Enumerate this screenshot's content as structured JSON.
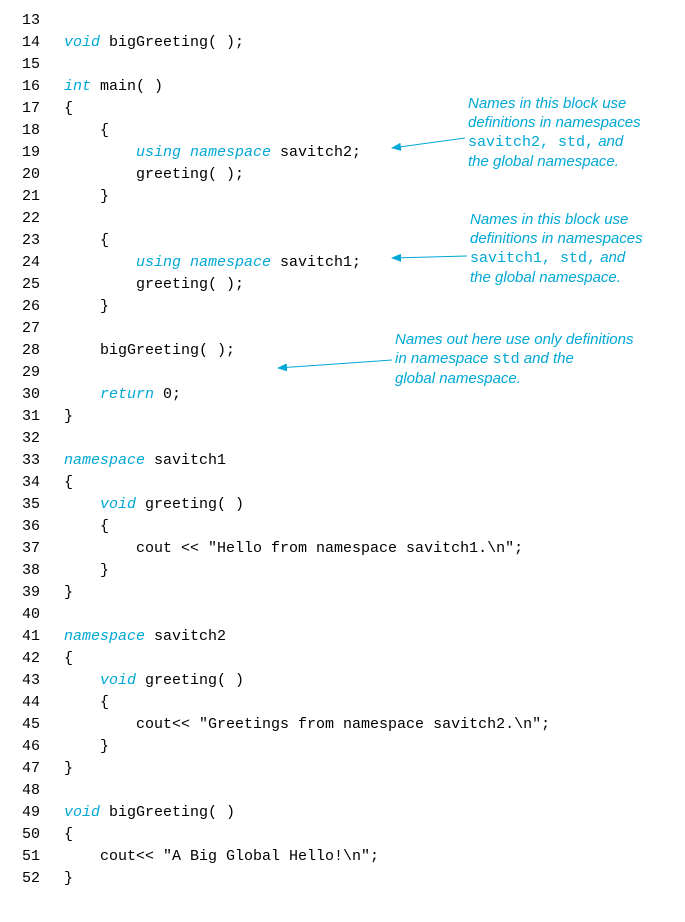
{
  "lines": [
    {
      "n": "13",
      "indent": "",
      "tokens": []
    },
    {
      "n": "14",
      "indent": "",
      "tokens": [
        {
          "t": "void",
          "c": "kw"
        },
        {
          "t": " bigGreeting( );"
        }
      ]
    },
    {
      "n": "15",
      "indent": "",
      "tokens": []
    },
    {
      "n": "16",
      "indent": "",
      "tokens": [
        {
          "t": "int",
          "c": "kw"
        },
        {
          "t": " main( )"
        }
      ]
    },
    {
      "n": "17",
      "indent": "",
      "tokens": [
        {
          "t": "{"
        }
      ]
    },
    {
      "n": "18",
      "indent": "    ",
      "tokens": [
        {
          "t": "{"
        }
      ]
    },
    {
      "n": "19",
      "indent": "        ",
      "tokens": [
        {
          "t": "using namespace",
          "c": "kw"
        },
        {
          "t": " savitch2;"
        }
      ]
    },
    {
      "n": "20",
      "indent": "        ",
      "tokens": [
        {
          "t": "greeting( );"
        }
      ]
    },
    {
      "n": "21",
      "indent": "    ",
      "tokens": [
        {
          "t": "}"
        }
      ]
    },
    {
      "n": "22",
      "indent": "",
      "tokens": []
    },
    {
      "n": "23",
      "indent": "    ",
      "tokens": [
        {
          "t": "{"
        }
      ]
    },
    {
      "n": "24",
      "indent": "        ",
      "tokens": [
        {
          "t": "using namespace",
          "c": "kw"
        },
        {
          "t": " savitch1;"
        }
      ]
    },
    {
      "n": "25",
      "indent": "        ",
      "tokens": [
        {
          "t": "greeting( );"
        }
      ]
    },
    {
      "n": "26",
      "indent": "    ",
      "tokens": [
        {
          "t": "}"
        }
      ]
    },
    {
      "n": "27",
      "indent": "",
      "tokens": []
    },
    {
      "n": "28",
      "indent": "    ",
      "tokens": [
        {
          "t": "bigGreeting( );"
        }
      ]
    },
    {
      "n": "29",
      "indent": "",
      "tokens": []
    },
    {
      "n": "30",
      "indent": "    ",
      "tokens": [
        {
          "t": "return",
          "c": "kw"
        },
        {
          "t": " 0;"
        }
      ]
    },
    {
      "n": "31",
      "indent": "",
      "tokens": [
        {
          "t": "}"
        }
      ]
    },
    {
      "n": "32",
      "indent": "",
      "tokens": []
    },
    {
      "n": "33",
      "indent": "",
      "tokens": [
        {
          "t": "namespace",
          "c": "kw"
        },
        {
          "t": " savitch1"
        }
      ]
    },
    {
      "n": "34",
      "indent": "",
      "tokens": [
        {
          "t": "{"
        }
      ]
    },
    {
      "n": "35",
      "indent": "    ",
      "tokens": [
        {
          "t": "void",
          "c": "kw"
        },
        {
          "t": " greeting( )"
        }
      ]
    },
    {
      "n": "36",
      "indent": "    ",
      "tokens": [
        {
          "t": "{"
        }
      ]
    },
    {
      "n": "37",
      "indent": "        ",
      "tokens": [
        {
          "t": "cout << \"Hello from namespace savitch1.\\n\";"
        }
      ]
    },
    {
      "n": "38",
      "indent": "    ",
      "tokens": [
        {
          "t": "}"
        }
      ]
    },
    {
      "n": "39",
      "indent": "",
      "tokens": [
        {
          "t": "}"
        }
      ]
    },
    {
      "n": "40",
      "indent": "",
      "tokens": []
    },
    {
      "n": "41",
      "indent": "",
      "tokens": [
        {
          "t": "namespace",
          "c": "kw"
        },
        {
          "t": " savitch2"
        }
      ]
    },
    {
      "n": "42",
      "indent": "",
      "tokens": [
        {
          "t": "{"
        }
      ]
    },
    {
      "n": "43",
      "indent": "    ",
      "tokens": [
        {
          "t": "void",
          "c": "kw"
        },
        {
          "t": " greeting( )"
        }
      ]
    },
    {
      "n": "44",
      "indent": "    ",
      "tokens": [
        {
          "t": "{"
        }
      ]
    },
    {
      "n": "45",
      "indent": "        ",
      "tokens": [
        {
          "t": "cout<< \"Greetings from namespace savitch2.\\n\";"
        }
      ]
    },
    {
      "n": "46",
      "indent": "    ",
      "tokens": [
        {
          "t": "}"
        }
      ]
    },
    {
      "n": "47",
      "indent": "",
      "tokens": [
        {
          "t": "}"
        }
      ]
    },
    {
      "n": "48",
      "indent": "",
      "tokens": []
    },
    {
      "n": "49",
      "indent": "",
      "tokens": [
        {
          "t": "void",
          "c": "kw"
        },
        {
          "t": " bigGreeting( )"
        }
      ]
    },
    {
      "n": "50",
      "indent": "",
      "tokens": [
        {
          "t": "{"
        }
      ]
    },
    {
      "n": "51",
      "indent": "    ",
      "tokens": [
        {
          "t": "cout<< \"A Big Global Hello!\\n\";"
        }
      ]
    },
    {
      "n": "52",
      "indent": "",
      "tokens": [
        {
          "t": "}"
        }
      ]
    }
  ],
  "annotations": {
    "a1": {
      "pre1": "Names in this block use",
      "pre2": "definitions in namespaces",
      "mono": "savitch2, std,",
      "post2": " and",
      "line4": "the global namespace."
    },
    "a2": {
      "pre1": "Names in this block use",
      "pre2": "definitions in namespaces",
      "mono": "savitch1, std,",
      "post2": " and",
      "line4": "the global namespace."
    },
    "a3": {
      "line1": "Names out here use only definitions",
      "pre2": "in namespace ",
      "mono": "std",
      "post2": " and the",
      "line3": "global namespace."
    }
  }
}
